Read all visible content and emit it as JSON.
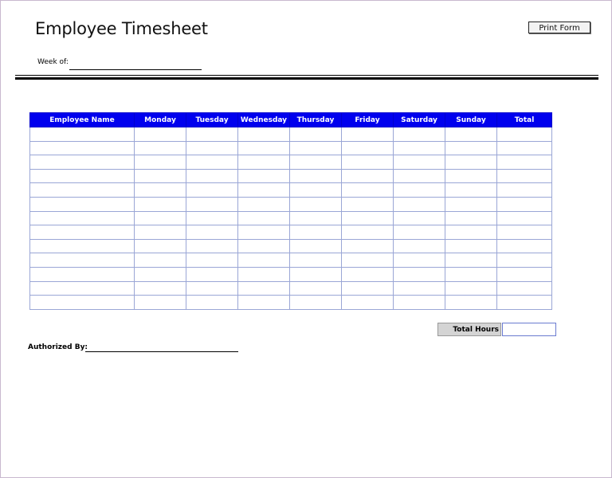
{
  "form": {
    "title": "Employee Timesheet",
    "print_button": "Print Form",
    "week_of_label": "Week of:",
    "authorized_by_label": "Authorized By:",
    "total_hours_label": "Total Hours"
  },
  "table": {
    "columns": [
      "Employee Name",
      "Monday",
      "Tuesday",
      "Wednesday",
      "Thursday",
      "Friday",
      "Saturday",
      "Sunday",
      "Total"
    ],
    "row_count": 13
  },
  "colors": {
    "header_bg": "#0000ee",
    "header_text": "#ffffff",
    "grid_line": "#9aa6d6",
    "total_label_bg": "#d4d4d4"
  }
}
